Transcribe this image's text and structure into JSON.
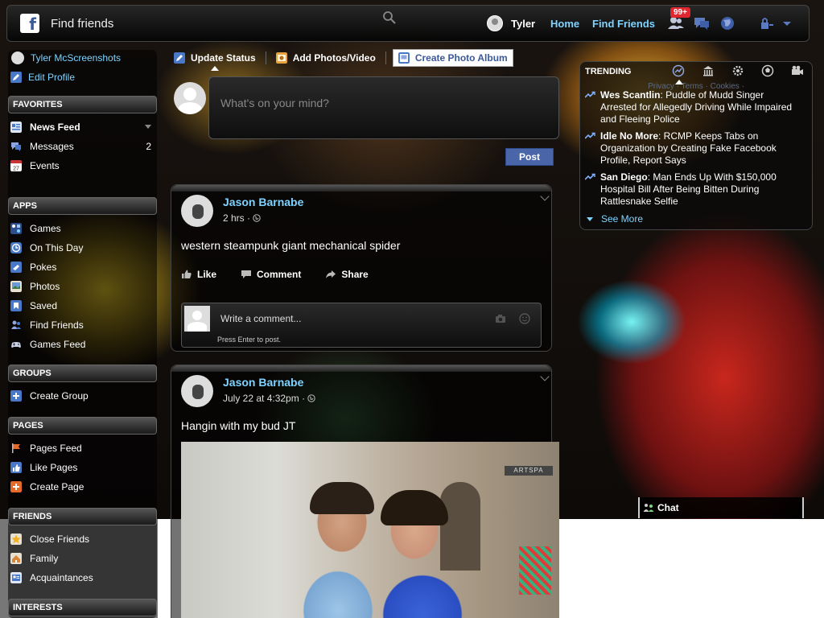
{
  "header": {
    "search_placeholder": "Find friends",
    "user_name": "Tyler",
    "nav": {
      "home": "Home",
      "find_friends": "Find Friends"
    },
    "notifications_badge": "99+"
  },
  "sidebar": {
    "profile_name": "Tyler McScreenshots",
    "edit_profile": "Edit Profile",
    "sections": {
      "favorites": "FAVORITES",
      "apps": "APPS",
      "groups": "GROUPS",
      "pages": "PAGES",
      "friends": "FRIENDS",
      "interests": "INTERESTS"
    },
    "favorites": [
      {
        "label": "News Feed",
        "icon": "news-feed-icon"
      },
      {
        "label": "Messages",
        "count": "2",
        "icon": "messages-icon"
      },
      {
        "label": "Events",
        "icon": "calendar-icon",
        "icon_text": "27"
      }
    ],
    "apps": [
      {
        "label": "Games",
        "icon": "games-icon"
      },
      {
        "label": "On This Day",
        "icon": "clock-icon"
      },
      {
        "label": "Pokes",
        "icon": "poke-icon"
      },
      {
        "label": "Photos",
        "icon": "photos-icon"
      },
      {
        "label": "Saved",
        "icon": "bookmark-icon"
      },
      {
        "label": "Find Friends",
        "icon": "find-friends-icon"
      },
      {
        "label": "Games Feed",
        "icon": "gamepad-icon"
      }
    ],
    "groups": [
      {
        "label": "Create Group",
        "icon": "plus-icon"
      }
    ],
    "pages": [
      {
        "label": "Pages Feed",
        "icon": "flag-icon"
      },
      {
        "label": "Like Pages",
        "icon": "thumbs-up-icon"
      },
      {
        "label": "Create Page",
        "icon": "plus-icon"
      }
    ],
    "friends": [
      {
        "label": "Close Friends",
        "icon": "star-icon"
      },
      {
        "label": "Family",
        "icon": "family-icon"
      },
      {
        "label": "Acquaintances",
        "icon": "acquaintances-icon"
      }
    ]
  },
  "composer": {
    "tabs": {
      "update_status": "Update Status",
      "add_photos": "Add Photos/Video",
      "create_album": "Create Photo Album"
    },
    "placeholder": "What's on your mind?",
    "post_label": "Post"
  },
  "posts": [
    {
      "author": "Jason Barnabe",
      "time": "2 hrs",
      "text": "western steampunk giant mechanical spider",
      "actions": {
        "like": "Like",
        "comment": "Comment",
        "share": "Share"
      },
      "comment_placeholder": "Write a comment...",
      "comment_hint": "Press Enter to post."
    },
    {
      "author": "Jason Barnabe",
      "time": "July 22 at 4:32pm",
      "text": "Hangin with my bud JT",
      "photo_sign": "ARTSPA"
    }
  ],
  "trending": {
    "title": "TRENDING",
    "faint_links": "Privacy · Terms · Cookies ·",
    "items": [
      {
        "name": "Wes Scantlin",
        "text": ": Puddle of Mudd Singer Arrested for Allegedly Driving While Impaired and Fleeing Police"
      },
      {
        "name": "Idle No More",
        "text": ": RCMP Keeps Tabs on Organization by Creating Fake Facebook Profile, Report Says"
      },
      {
        "name": "San Diego",
        "text": ": Man Ends Up With $150,000 Hospital Bill After Being Bitten During Rattlesnake Selfie"
      }
    ],
    "see_more": "See More"
  },
  "chat": {
    "label": "Chat"
  },
  "colors": {
    "link": "#7fd3ff",
    "fb_blue": "#3b5998",
    "post_button": "#4a66a8",
    "badge_red": "#e0262e"
  }
}
